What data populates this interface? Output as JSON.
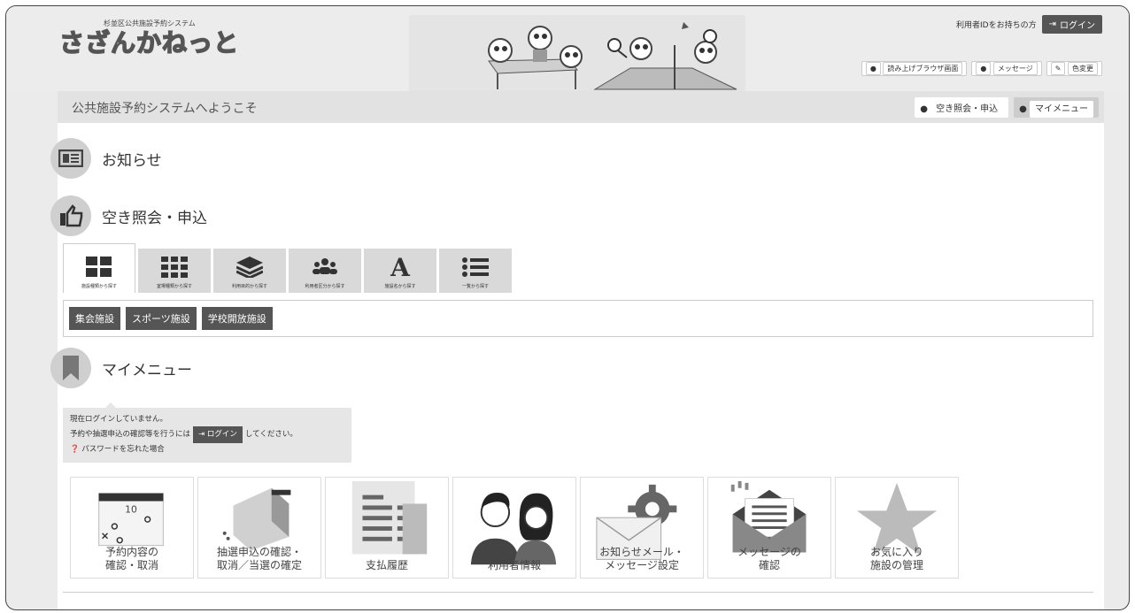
{
  "header": {
    "logo_sub": "杉並区公共施設予約システム",
    "logo_main": "さざんかねっと",
    "id_holder_text": "利用者IDをお持ちの方",
    "login_label": "ログイン",
    "links": [
      {
        "icon": "microphone-icon",
        "label": "読み上げブラウザ画面"
      },
      {
        "icon": "chat-bubble-icon",
        "label": "メッセージ"
      },
      {
        "icon": "brush-icon",
        "label": "色変更"
      }
    ]
  },
  "welcome": {
    "title": "公共施設予約システムへようこそ",
    "btn_availability": "空き照会・申込",
    "btn_mymenu": "マイメニュー"
  },
  "sections": {
    "notice": "お知らせ",
    "availability": "空き照会・申込",
    "mymenu": "マイメニュー"
  },
  "search_tabs": [
    {
      "icon": "grid-4-icon",
      "label": "施設種類から探す"
    },
    {
      "icon": "grid-9-icon",
      "label": "室場種類から探す"
    },
    {
      "icon": "layers-icon",
      "label": "利用目的から探す"
    },
    {
      "icon": "people-icon",
      "label": "利用者区分から探す"
    },
    {
      "icon": "letter-a-icon",
      "label": "施設名から探す"
    },
    {
      "icon": "list-icon",
      "label": "一覧から探す"
    }
  ],
  "categories": [
    "集会施設",
    "スポーツ施設",
    "学校開放施設"
  ],
  "login_notice": {
    "line1": "現在ログインしていません。",
    "line2_pre": "予約や抽選申込の確認等を行うには",
    "login_label": "ログイン",
    "line2_post": "してください。",
    "forgot": "パスワードを忘れた場合"
  },
  "menu_cards": [
    {
      "label": "予約内容の\n確認・取消"
    },
    {
      "label": "抽選申込の確認・\n取消／当選の確定"
    },
    {
      "label": "支払履歴"
    },
    {
      "label": "利用者情報"
    },
    {
      "label": "お知らせメール・\nメッセージ設定"
    },
    {
      "label": "メッセージの\n確認"
    },
    {
      "label": "お気に入り\n施設の管理"
    }
  ],
  "calendar_number": "10"
}
